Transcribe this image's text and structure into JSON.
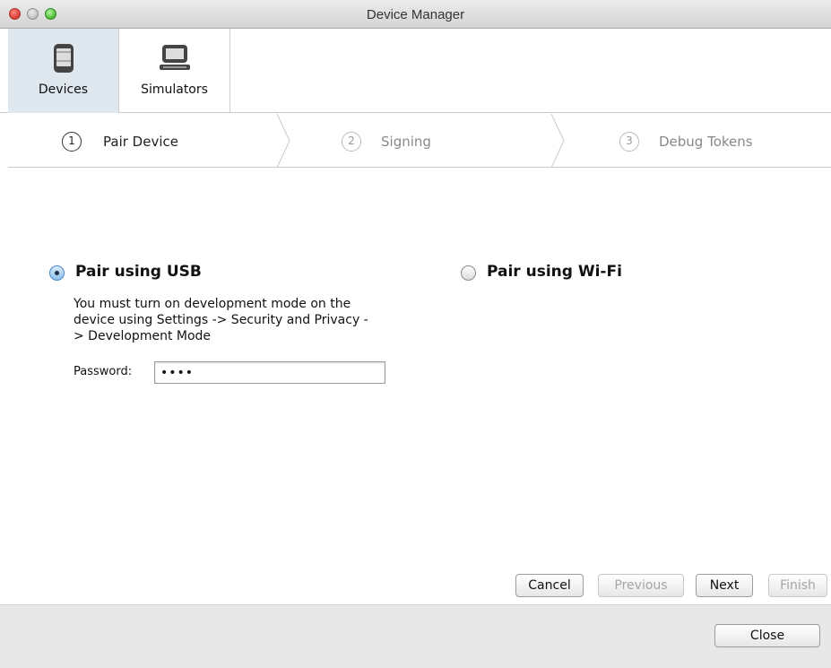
{
  "window": {
    "title": "Device Manager"
  },
  "toolbar": {
    "devices_label": "Devices",
    "simulators_label": "Simulators"
  },
  "steps": [
    {
      "num": "1",
      "label": "Pair Device"
    },
    {
      "num": "2",
      "label": "Signing"
    },
    {
      "num": "3",
      "label": "Debug Tokens"
    }
  ],
  "usb": {
    "label": "Pair using USB",
    "selected": true,
    "description": "You must turn on development mode on the device using Settings -> Security and Privacy -> Development Mode",
    "password_label": "Password:",
    "password_value": "••••"
  },
  "wifi": {
    "label": "Pair using Wi-Fi",
    "selected": false
  },
  "buttons": {
    "cancel": "Cancel",
    "previous": "Previous",
    "next": "Next",
    "finish": "Finish",
    "close": "Close"
  },
  "colors": {
    "toolbar_selected": "#dfe8ee",
    "footer": "#e8e8e8",
    "radio_selected": "#8fc0ec"
  }
}
